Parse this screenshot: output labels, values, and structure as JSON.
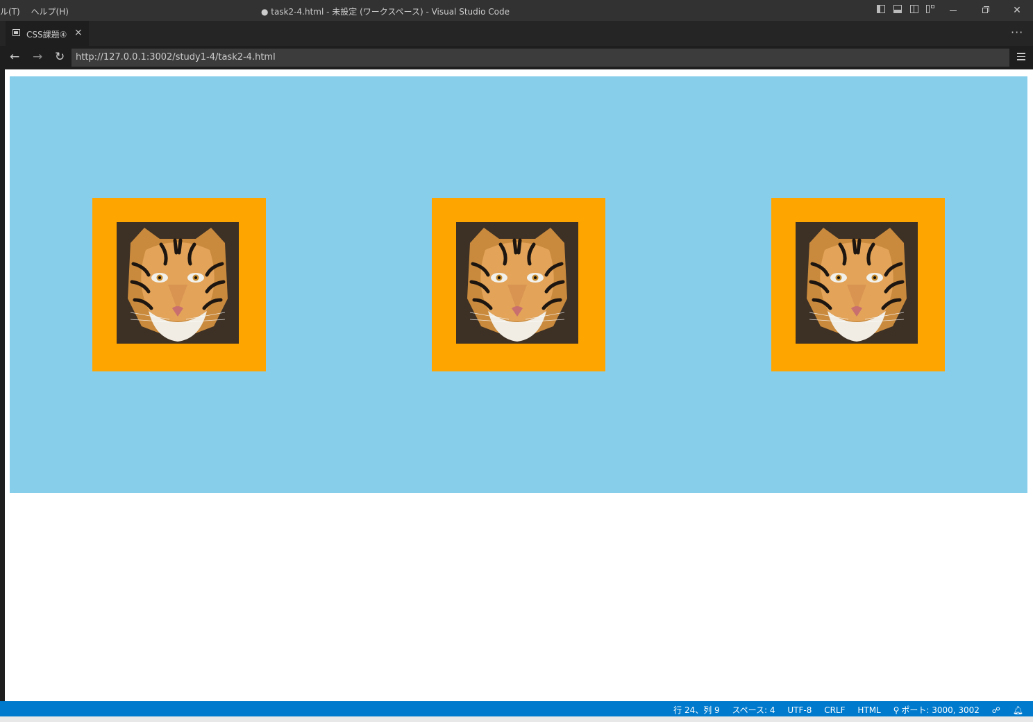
{
  "titlebar": {
    "menu": [
      "ル(T)",
      "ヘルプ(H)"
    ],
    "title": "● task2-4.html - 未設定 (ワークスペース) - Visual Studio Code"
  },
  "tab": {
    "label": "CSS課題④",
    "close": "×"
  },
  "navbar": {
    "url": "http://127.0.0.1:3002/study1-4/task2-4.html",
    "back": "←",
    "forward": "→",
    "reload": "↻"
  },
  "more_actions": "···",
  "page": {
    "background_color": "#87ceeb",
    "frame_color": "#ffa500",
    "images": [
      "tiger-photo",
      "tiger-photo",
      "tiger-photo"
    ]
  },
  "statusbar": {
    "position": "行 24、列 9",
    "spaces": "スペース: 4",
    "encoding": "UTF-8",
    "eol": "CRLF",
    "language": "HTML",
    "ports": "ポート: 3000, 3002"
  }
}
